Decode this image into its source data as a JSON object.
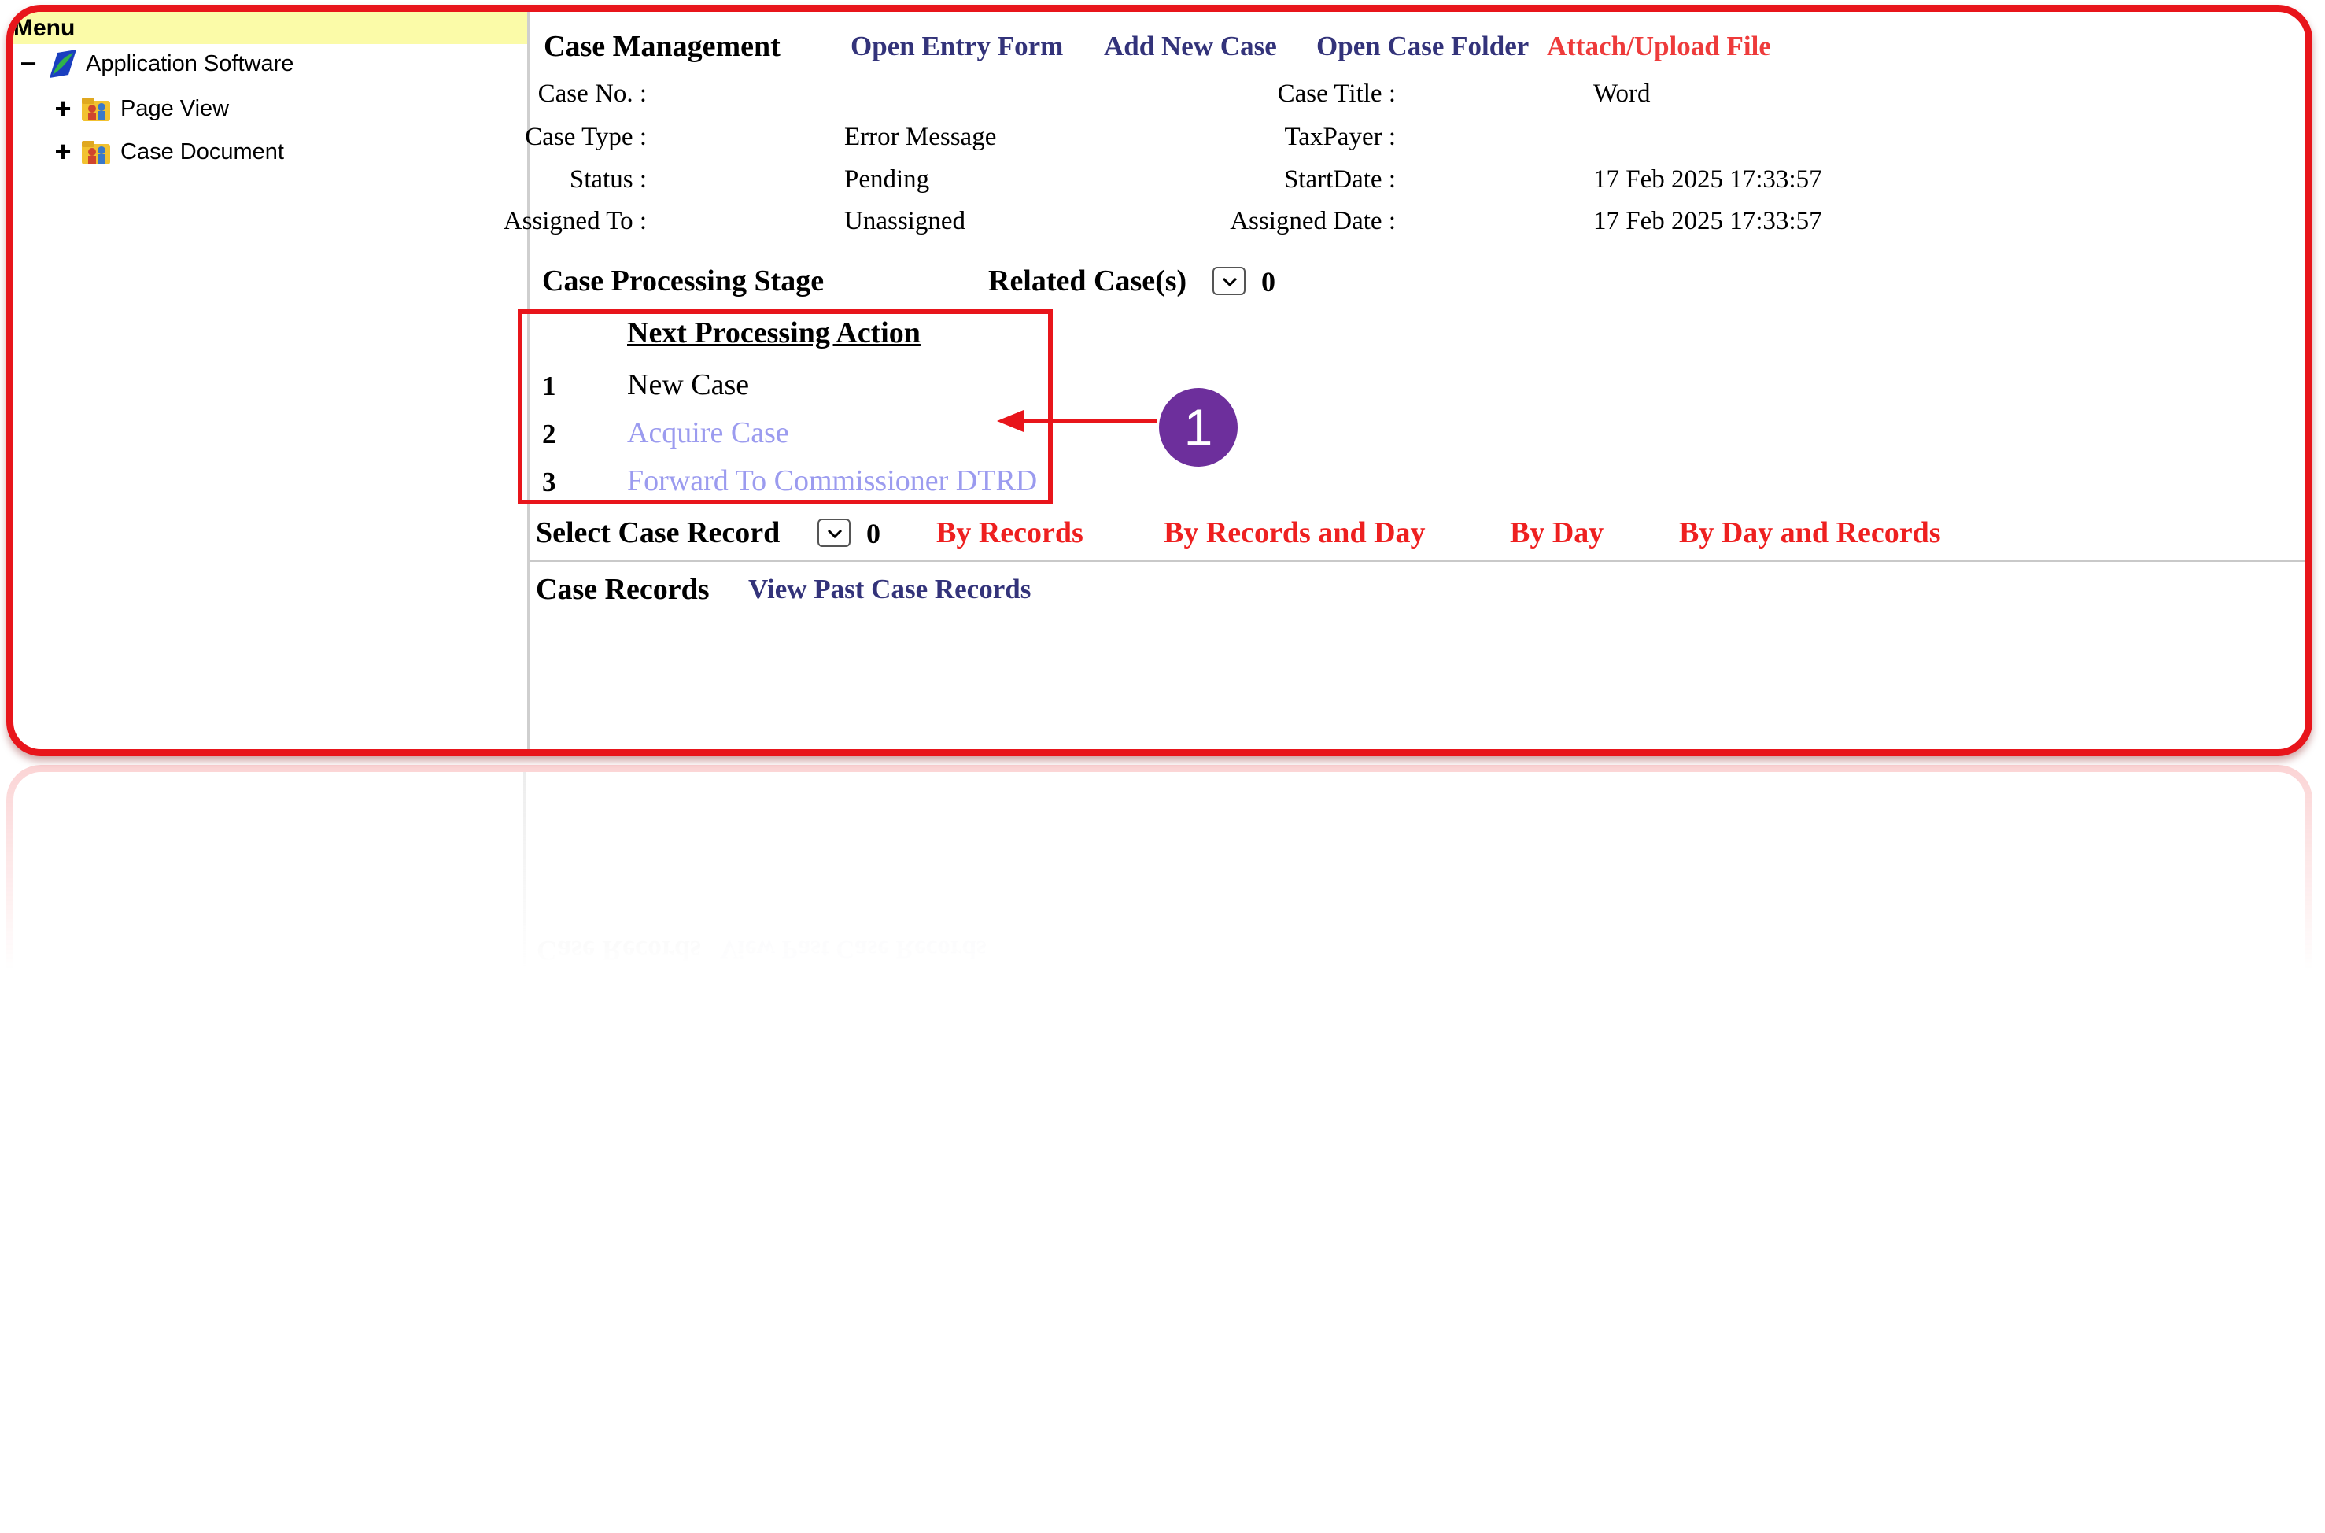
{
  "menu": {
    "header": "Menu",
    "tree": [
      {
        "toggle": "−",
        "label": "Application Software"
      },
      {
        "toggle": "+",
        "label": "Page View"
      },
      {
        "toggle": "+",
        "label": "Case Document"
      }
    ]
  },
  "toolbar": {
    "title": "Case Management",
    "links": [
      "Open Entry Form",
      "Add New Case",
      "Open Case Folder",
      "Attach/Upload File"
    ]
  },
  "case_info": {
    "case_no_label": "Case No. :",
    "case_no_value": "",
    "case_type_label": "Case Type :",
    "case_type_value": "Error Message",
    "status_label": "Status :",
    "status_value": "Pending",
    "assigned_to_label": "Assigned To :",
    "assigned_to_value": "Unassigned",
    "case_title_label": "Case Title :",
    "case_title_value": "Word",
    "taxpayer_label": "TaxPayer :",
    "taxpayer_value": "",
    "start_date_label": "StartDate :",
    "start_date_value": "17 Feb 2025 17:33:57",
    "assigned_date_label": "Assigned Date :",
    "assigned_date_value": "17 Feb 2025 17:33:57"
  },
  "processing": {
    "stage_label": "Case Processing Stage",
    "related_label": "Related Case(s)",
    "related_count": "0",
    "next_action_title": "Next Processing Action",
    "actions": [
      {
        "num": "1",
        "label": "New Case",
        "enabled": false
      },
      {
        "num": "2",
        "label": "Acquire Case",
        "enabled": true
      },
      {
        "num": "3",
        "label": "Forward To Commissioner DTRD",
        "enabled": true
      }
    ]
  },
  "records_bar": {
    "select_label": "Select Case Record",
    "count": "0",
    "filters": [
      "By Records",
      "By Records and Day",
      "By Day",
      "By Day and Records"
    ]
  },
  "case_records": {
    "title": "Case Records",
    "view_past_link": "View Past Case Records"
  },
  "annotation": {
    "callout_number": "1"
  },
  "colors": {
    "frame_border": "#e8151b",
    "menu_header_bg": "#fbfba8",
    "link_blue": "#33337a",
    "link_red": "#ee2020",
    "action_link": "#9b9bef",
    "callout_purple": "#6d2f9c"
  },
  "icons": [
    "app-software-icon",
    "folder-people-icon",
    "dropdown-arrow-icon"
  ]
}
